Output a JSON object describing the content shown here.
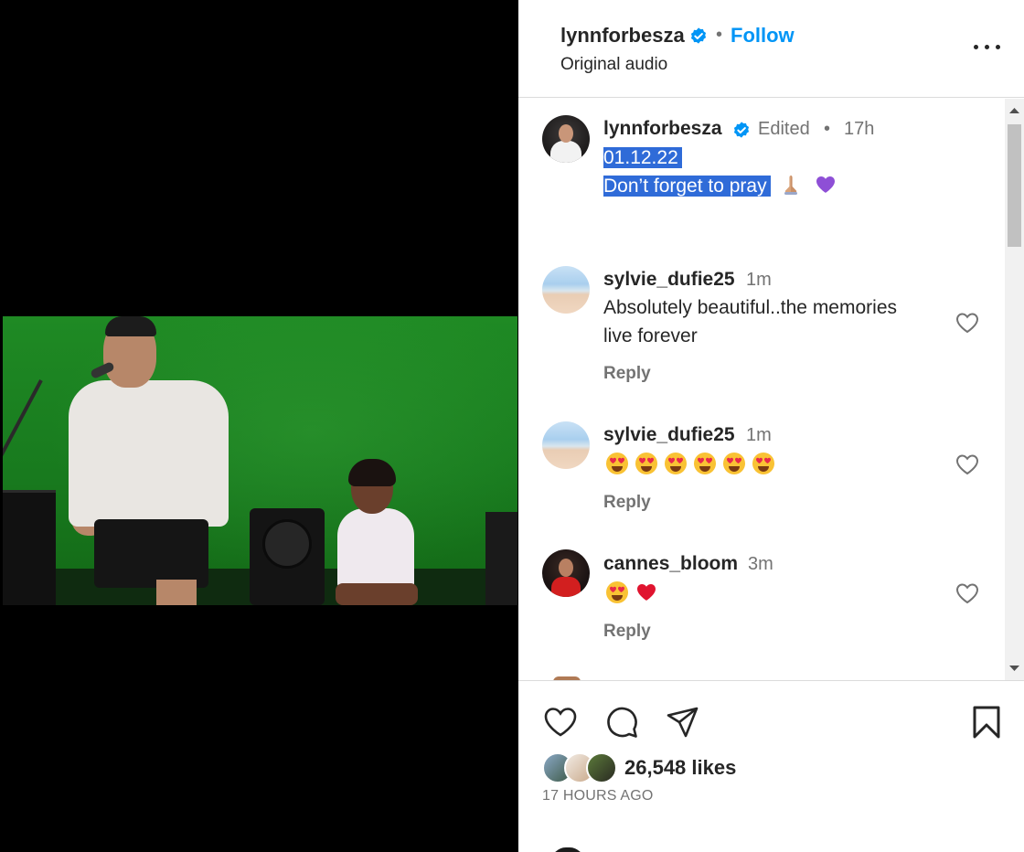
{
  "post": {
    "username": "lynnforbesza",
    "follow_label": "Follow",
    "separator": "•",
    "audio_label": "Original audio"
  },
  "caption": {
    "username": "lynnforbesza",
    "edited": "Edited",
    "separator": "•",
    "time": "17h",
    "line1": "01.12.22",
    "line2": "Don’t forget to pray"
  },
  "comments": [
    {
      "username": "sylvie_dufie25",
      "time": "1m",
      "text_line1": "Absolutely beautiful..the memories",
      "text_line2": "live forever",
      "reply_label": "Reply"
    },
    {
      "username": "sylvie_dufie25",
      "time": "1m",
      "emojis": [
        "heart-eyes",
        "heart-eyes",
        "heart-eyes",
        "heart-eyes",
        "heart-eyes",
        "heart-eyes"
      ],
      "reply_label": "Reply"
    },
    {
      "username": "cannes_bloom",
      "time": "3m",
      "emojis": [
        "heart-eyes",
        "red-heart"
      ],
      "reply_label": "Reply"
    }
  ],
  "actions": {
    "likes": "26,548 likes",
    "timestamp": "17 HOURS AGO"
  },
  "colors": {
    "accent": "#0095f6",
    "selection": "#2f6bd8",
    "muted": "#737373",
    "green_screen": "#1f8a24"
  },
  "icons": [
    "more-options-icon",
    "verified-badge-icon",
    "like-heart-icon",
    "comment-icon",
    "share-icon",
    "save-bookmark-icon",
    "praying-hands-emoji",
    "purple-heart-emoji",
    "heart-eyes-emoji",
    "red-heart-emoji"
  ]
}
